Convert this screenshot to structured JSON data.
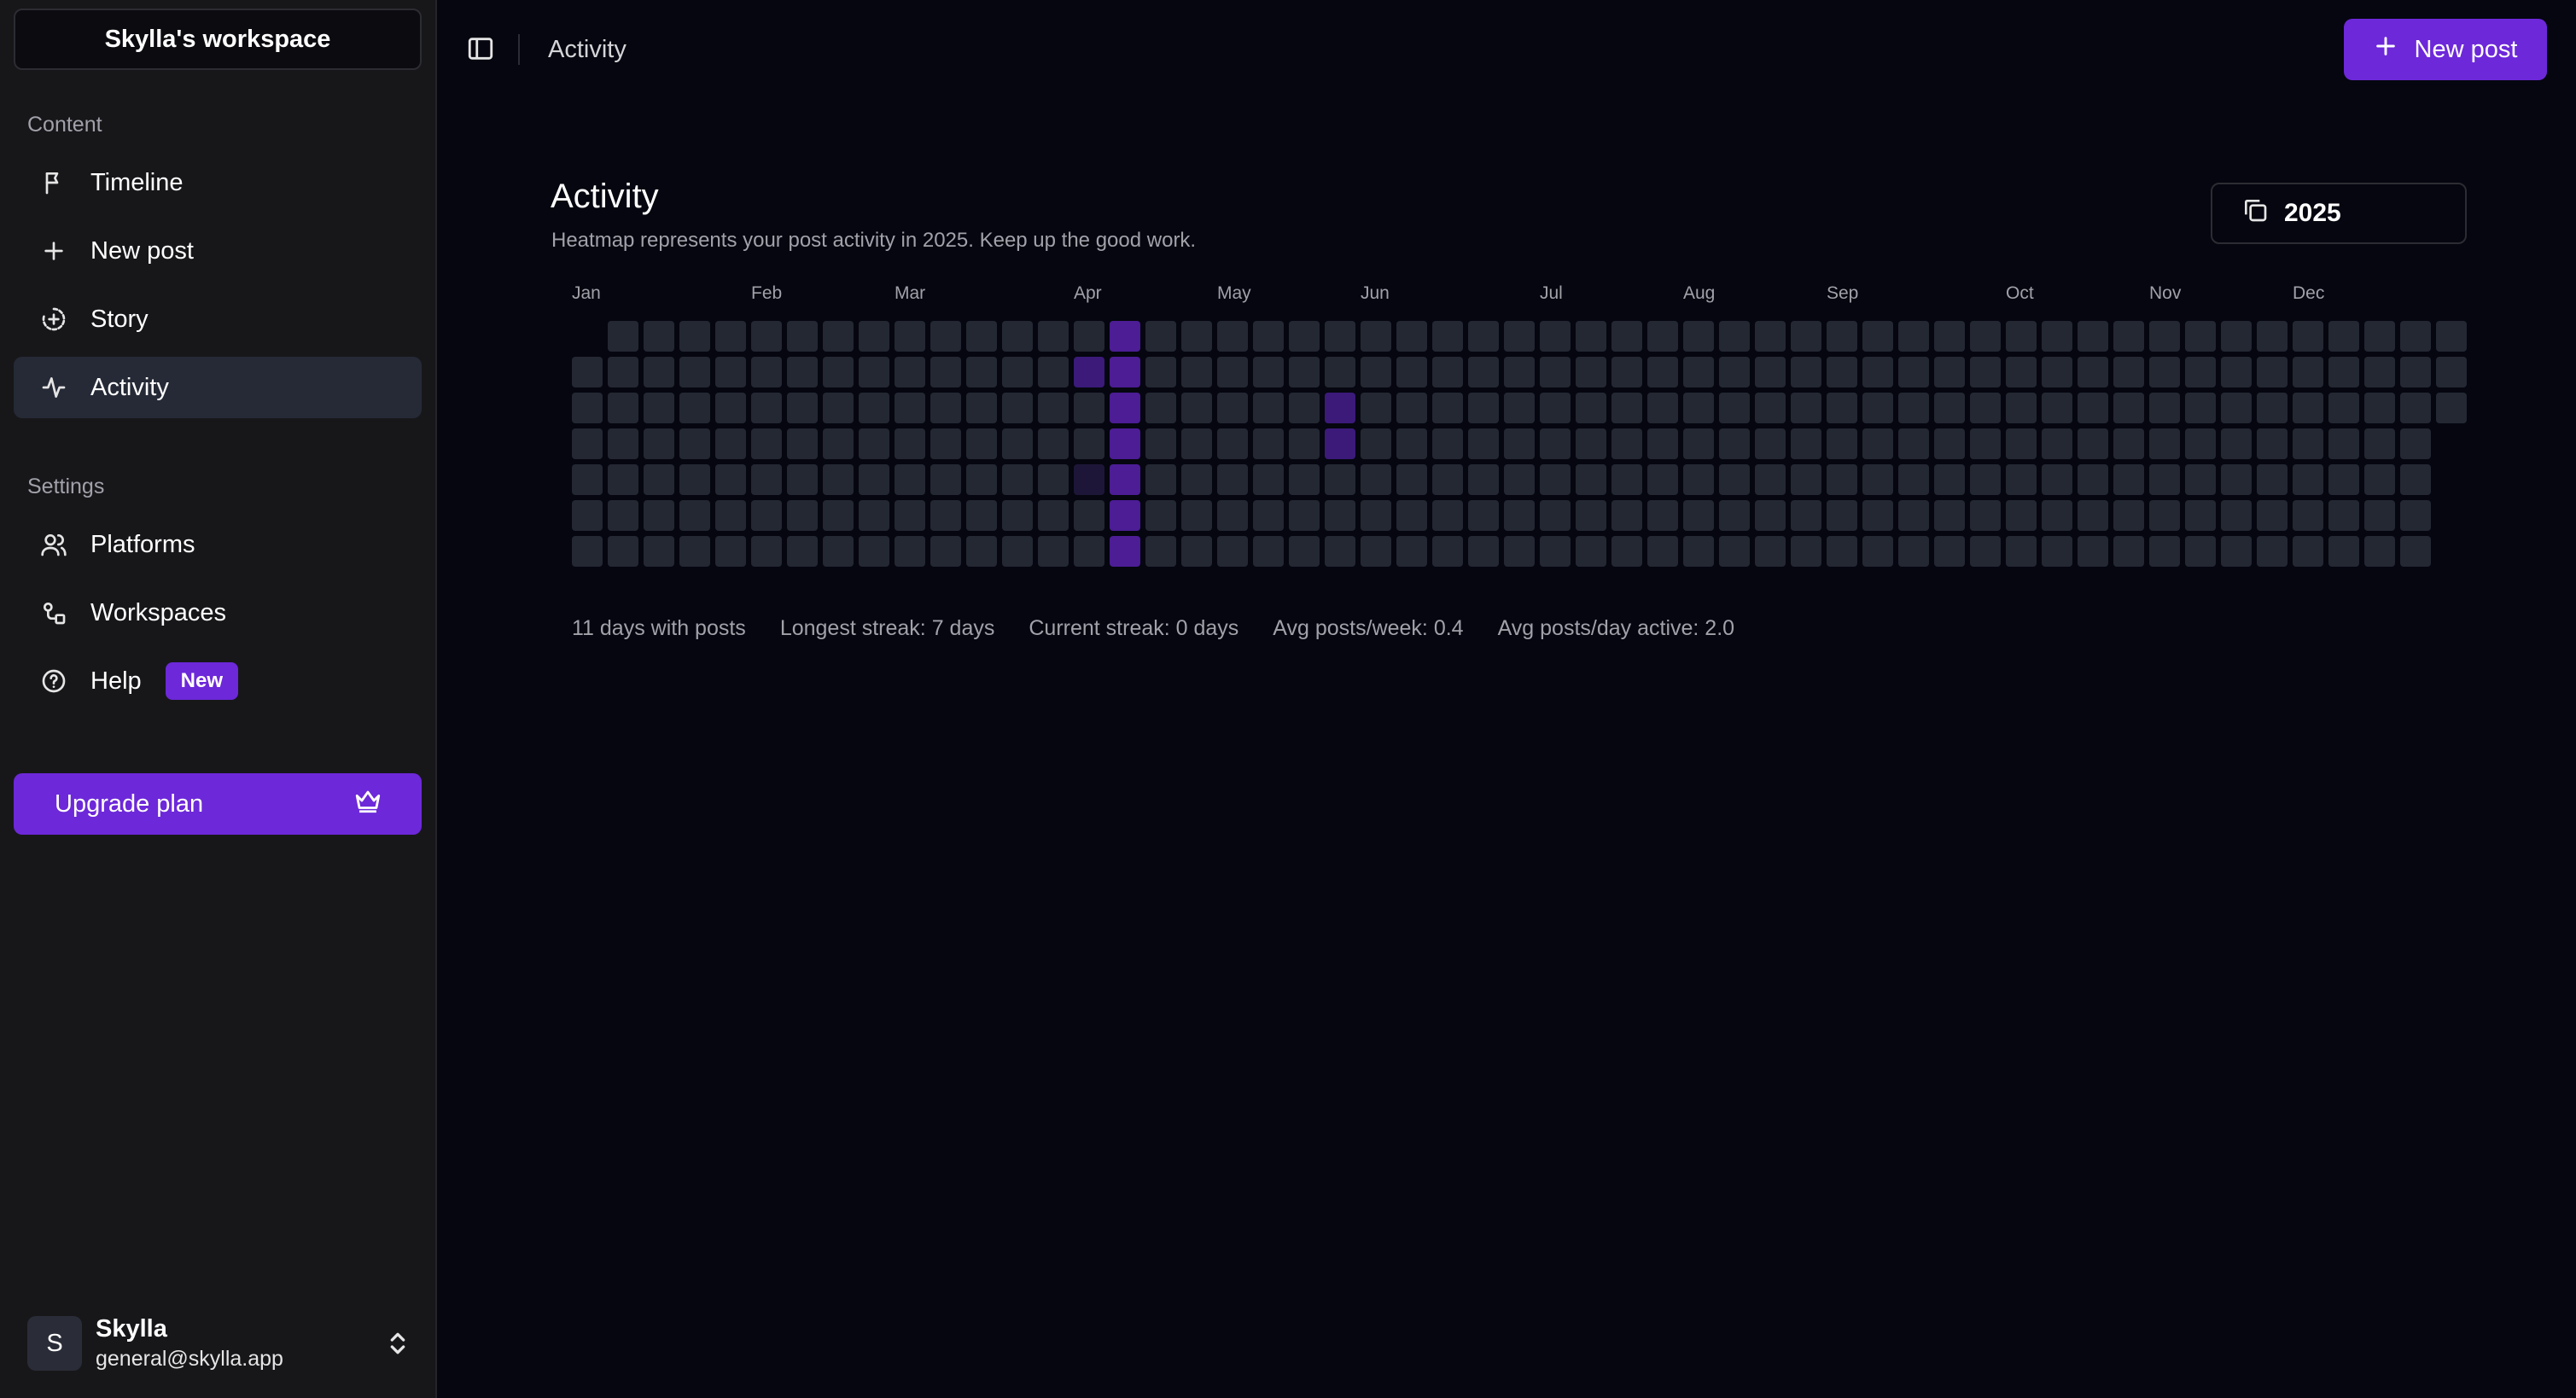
{
  "sidebar": {
    "workspace_name": "Skylla's workspace",
    "content_label": "Content",
    "content_items": [
      {
        "label": "Timeline",
        "icon": "flag-icon"
      },
      {
        "label": "New post",
        "icon": "plus-icon"
      },
      {
        "label": "Story",
        "icon": "story-icon"
      },
      {
        "label": "Activity",
        "icon": "activity-icon",
        "active": true
      }
    ],
    "settings_label": "Settings",
    "settings_items": [
      {
        "label": "Platforms",
        "icon": "users-icon"
      },
      {
        "label": "Workspaces",
        "icon": "workspaces-icon"
      },
      {
        "label": "Help",
        "icon": "help-icon",
        "badge": "New"
      }
    ],
    "upgrade_label": "Upgrade plan",
    "user": {
      "initial": "S",
      "name": "Skylla",
      "email": "general@skylla.app"
    }
  },
  "header": {
    "title": "Activity",
    "new_post_label": "New post"
  },
  "main": {
    "title": "Activity",
    "subtitle": "Heatmap represents your post activity in 2025. Keep up the good work.",
    "year": "2025",
    "stats": [
      "11 days with posts",
      "Longest streak: 7 days",
      "Current streak: 0 days",
      "Avg posts/week: 0.4",
      "Avg posts/day active: 2.0"
    ]
  },
  "colors": {
    "accent": "#6d28d9",
    "cell_empty": "#242833",
    "cell_low": "#1e1638",
    "cell_mid": "#3b1a7a",
    "cell_high": "#4c1d95"
  },
  "chart_data": {
    "type": "heatmap",
    "year": 2025,
    "months": [
      "Jan",
      "Feb",
      "Mar",
      "Apr",
      "May",
      "Jun",
      "Jul",
      "Aug",
      "Sep",
      "Oct",
      "Nov",
      "Dec"
    ],
    "month_start_weeks": [
      0,
      5,
      9,
      14,
      18,
      22,
      27,
      31,
      35,
      40,
      44,
      48
    ],
    "weeks": 53,
    "first_week_start_row": 1,
    "last_week_end_row": 2,
    "active_cells": [
      {
        "week": 14,
        "row": 1,
        "level": 3
      },
      {
        "week": 14,
        "row": 4,
        "level": 1
      },
      {
        "week": 15,
        "row": 0,
        "level": 4
      },
      {
        "week": 15,
        "row": 1,
        "level": 4
      },
      {
        "week": 15,
        "row": 2,
        "level": 4
      },
      {
        "week": 15,
        "row": 3,
        "level": 4
      },
      {
        "week": 15,
        "row": 4,
        "level": 4
      },
      {
        "week": 15,
        "row": 5,
        "level": 4
      },
      {
        "week": 15,
        "row": 6,
        "level": 4
      },
      {
        "week": 21,
        "row": 2,
        "level": 3
      },
      {
        "week": 21,
        "row": 3,
        "level": 3
      }
    ]
  }
}
